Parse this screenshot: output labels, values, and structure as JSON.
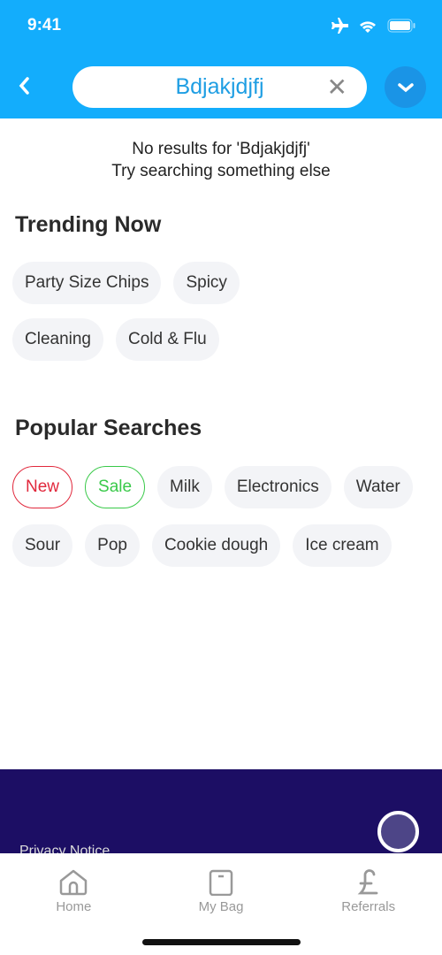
{
  "status": {
    "time": "9:41"
  },
  "search": {
    "value": "Bdjakjdjfj"
  },
  "no_results": {
    "line1": "No results for 'Bdjakjdjfj'",
    "line2": "Try searching something else"
  },
  "trending": {
    "title": "Trending Now",
    "row1": [
      "Party Size Chips",
      "Spicy"
    ],
    "row2": [
      "Cleaning",
      "Cold & Flu"
    ]
  },
  "popular": {
    "title": "Popular Searches",
    "row1": [
      "New",
      "Sale",
      "Milk",
      "Electronics",
      "Water"
    ],
    "row2": [
      "Sour",
      "Pop",
      "Cookie dough",
      "Ice cream"
    ]
  },
  "footer": {
    "privacy": "Privacy Notice"
  },
  "tabs": [
    {
      "label": "Home",
      "icon": "home-icon"
    },
    {
      "label": "My Bag",
      "icon": "bag-icon"
    },
    {
      "label": "Referrals",
      "icon": "pound-icon"
    }
  ],
  "colors": {
    "header": "#13adfc",
    "footer": "#1c0e64",
    "new": "#e1283c",
    "sale": "#39c949"
  }
}
